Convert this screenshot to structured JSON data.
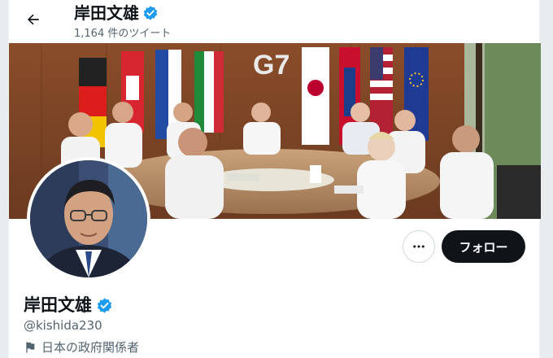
{
  "header": {
    "back_icon": "arrow-left-icon",
    "name": "岸田文雄",
    "verified_icon": "verified-badge-icon",
    "tweet_count": "1,164 件のツイート"
  },
  "banner": {
    "description_icon": "g7-summit-photo"
  },
  "profile": {
    "avatar_icon": "profile-photo",
    "more_icon": "more-horizontal-icon",
    "follow_label": "フォロー",
    "display_name": "岸田文雄",
    "verified_icon": "verified-badge-icon",
    "handle": "@kishida230",
    "label_icon": "flag-icon",
    "label": "日本の政府関係者"
  },
  "colors": {
    "verified": "#1d9bf0",
    "follow_bg": "#0f1419",
    "secondary_text": "#536471"
  }
}
